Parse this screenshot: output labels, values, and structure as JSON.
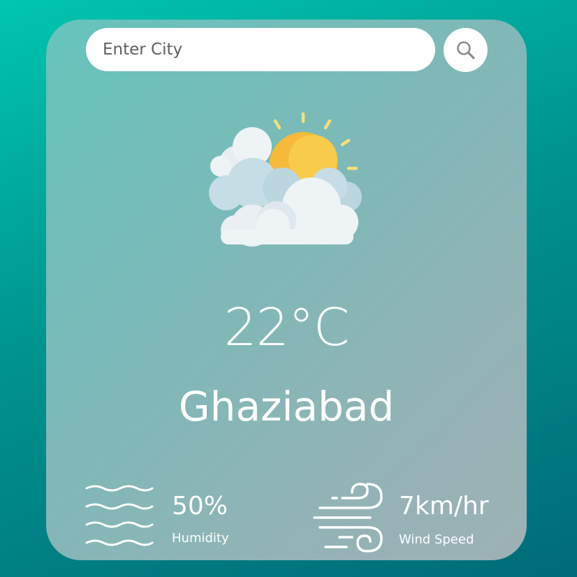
{
  "search": {
    "placeholder": "Enter City",
    "icon": "search-icon"
  },
  "weather": {
    "icon": "partly-cloudy-icon",
    "temperature": "22°C",
    "city": "Ghaziabad"
  },
  "details": {
    "humidity": {
      "value": "50%",
      "label": "Humidity",
      "icon": "humidity-waves-icon"
    },
    "wind": {
      "value": "7km/hr",
      "label": "Wind Speed",
      "icon": "wind-icon"
    }
  },
  "colors": {
    "background_start": "#00c6b0",
    "background_end": "#006b7a",
    "card": "#7fb8b7",
    "sun": "#f6b93b",
    "text": "#ffffff"
  }
}
